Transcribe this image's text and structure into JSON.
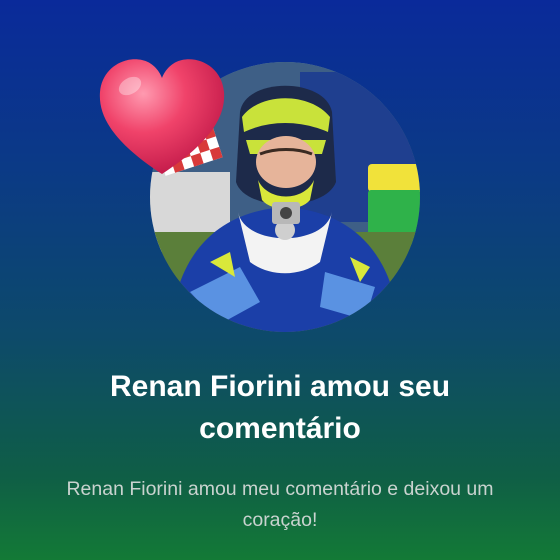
{
  "notification": {
    "title": "Renan Fiorini amou seu comentário",
    "message": "Renan Fiorini amou meu comentário e deixou um coração!"
  },
  "icons": {
    "reaction": "heart-balloon-icon",
    "avatar": "user-avatar-photo"
  },
  "colors": {
    "background_top": "#0a2a9a",
    "background_bottom": "#137a36",
    "heart": "#f0436a",
    "title_text": "#ffffff",
    "message_text": "#c9d3cf"
  }
}
